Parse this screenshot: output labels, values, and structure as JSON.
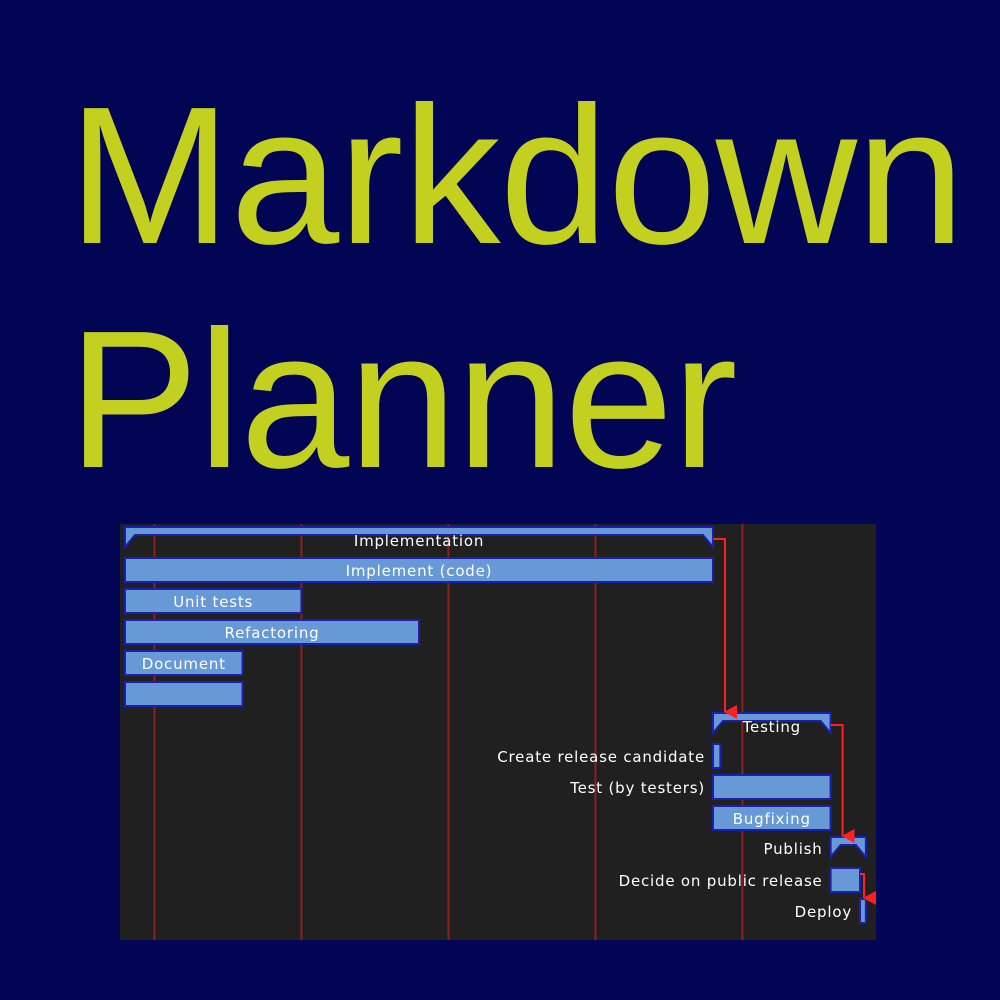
{
  "title": {
    "line1": "Markdown",
    "line2": "Planner"
  },
  "colors": {
    "background": "#020553",
    "title": "#c3d01f",
    "chart_background": "#202020",
    "bar_fill": "#6699d5",
    "bar_border": "#1a1fb0",
    "gridline": "#8a2020",
    "dependency_arrow": "#ff2020",
    "label_text": "#ffffff"
  },
  "gantt": {
    "groups": [
      {
        "name": "Implementation",
        "start": 0,
        "end": 20
      },
      {
        "name": "Testing",
        "start": 20,
        "end": 24
      },
      {
        "name": "Publish",
        "start": 24,
        "end": 25.2
      }
    ],
    "tasks": [
      {
        "name": "Implement (code)",
        "start": 0,
        "end": 20,
        "label_position": "inside"
      },
      {
        "name": "Unit tests",
        "start": 0,
        "end": 6,
        "label_position": "inside"
      },
      {
        "name": "Refactoring",
        "start": 0,
        "end": 10,
        "label_position": "inside"
      },
      {
        "name": "Document",
        "start": 0,
        "end": 4,
        "label_position": "inside"
      },
      {
        "name": "",
        "start": 0,
        "end": 4,
        "label_position": "inside"
      },
      {
        "name": "Create release candidate",
        "start": 20,
        "end": 20.25,
        "label_position": "left"
      },
      {
        "name": "Test (by testers)",
        "start": 20,
        "end": 24,
        "label_position": "left"
      },
      {
        "name": "Bugfixing",
        "start": 20,
        "end": 24,
        "label_position": "inside"
      },
      {
        "name": "Decide on public release",
        "start": 24,
        "end": 25,
        "label_position": "left"
      },
      {
        "name": "Deploy",
        "start": 25,
        "end": 25.2,
        "label_position": "left"
      }
    ],
    "rows": [
      {
        "kind": "group",
        "index": 0
      },
      {
        "kind": "task",
        "index": 0
      },
      {
        "kind": "task",
        "index": 1
      },
      {
        "kind": "task",
        "index": 2
      },
      {
        "kind": "task",
        "index": 3
      },
      {
        "kind": "task",
        "index": 4
      },
      {
        "kind": "group",
        "index": 1
      },
      {
        "kind": "task",
        "index": 5
      },
      {
        "kind": "task",
        "index": 6
      },
      {
        "kind": "task",
        "index": 7
      },
      {
        "kind": "group",
        "index": 2,
        "label_position": "left"
      },
      {
        "kind": "task",
        "index": 8
      },
      {
        "kind": "task",
        "index": 9
      }
    ],
    "dependencies": [
      {
        "from_group": 0,
        "to_group": 1
      },
      {
        "from_group": 1,
        "to_group": 2
      },
      {
        "from_task": 8,
        "to_task": 9
      }
    ],
    "gridlines": [
      1,
      6,
      11,
      16,
      21
    ],
    "time_range": [
      0,
      25.5
    ]
  }
}
